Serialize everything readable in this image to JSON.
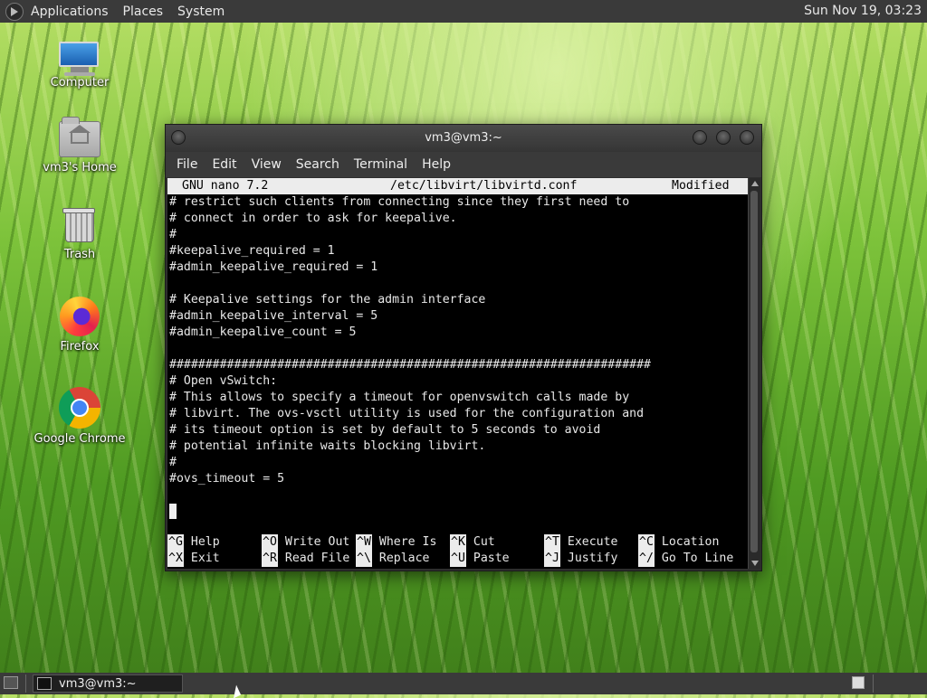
{
  "top_panel": {
    "menus": [
      "Applications",
      "Places",
      "System"
    ],
    "clock": "Sun Nov 19, 03:23"
  },
  "desktop_icons": [
    {
      "label": "Computer",
      "icon": "computer-icon"
    },
    {
      "label": "vm3's Home",
      "icon": "home-folder-icon"
    },
    {
      "label": "Trash",
      "icon": "trash-icon"
    },
    {
      "label": "Firefox",
      "icon": "firefox-icon"
    },
    {
      "label": "Google Chrome",
      "icon": "chrome-icon"
    }
  ],
  "window": {
    "title": "vm3@vm3:~",
    "menu": [
      "File",
      "Edit",
      "View",
      "Search",
      "Terminal",
      "Help"
    ]
  },
  "nano": {
    "version": "GNU nano 7.2",
    "file": "/etc/libvirt/libvirtd.conf",
    "status": "Modified",
    "lines": [
      "# restrict such clients from connecting since they first need to",
      "# connect in order to ask for keepalive.",
      "#",
      "#keepalive_required = 1",
      "#admin_keepalive_required = 1",
      "",
      "# Keepalive settings for the admin interface",
      "#admin_keepalive_interval = 5",
      "#admin_keepalive_count = 5",
      "",
      "###################################################################",
      "# Open vSwitch:",
      "# This allows to specify a timeout for openvswitch calls made by",
      "# libvirt. The ovs-vsctl utility is used for the configuration and",
      "# its timeout option is set by default to 5 seconds to avoid",
      "# potential infinite waits blocking libvirt.",
      "#",
      "#ovs_timeout = 5",
      ""
    ],
    "shortcuts_row1": [
      {
        "key": "^G",
        "label": "Help"
      },
      {
        "key": "^O",
        "label": "Write Out"
      },
      {
        "key": "^W",
        "label": "Where Is"
      },
      {
        "key": "^K",
        "label": "Cut"
      },
      {
        "key": "^T",
        "label": "Execute"
      },
      {
        "key": "^C",
        "label": "Location"
      }
    ],
    "shortcuts_row2": [
      {
        "key": "^X",
        "label": "Exit"
      },
      {
        "key": "^R",
        "label": "Read File"
      },
      {
        "key": "^\\",
        "label": "Replace"
      },
      {
        "key": "^U",
        "label": "Paste"
      },
      {
        "key": "^J",
        "label": "Justify"
      },
      {
        "key": "^/",
        "label": "Go To Line"
      }
    ]
  },
  "bottom_panel": {
    "task": "vm3@vm3:~"
  }
}
